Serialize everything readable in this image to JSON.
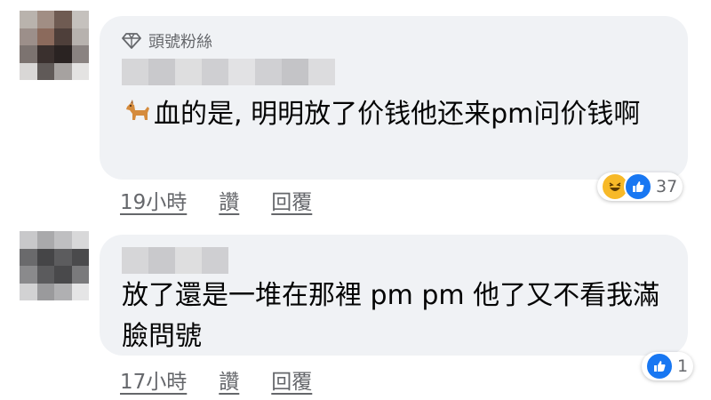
{
  "colors": {
    "bubble_bg": "#f0f2f5",
    "text_primary": "#050505",
    "text_secondary": "#65676b",
    "like_blue": "#1877f2",
    "haha_yellow": "#f7b928"
  },
  "comments": [
    {
      "badge_icon": "diamond-icon",
      "badge_label": "頭號粉絲",
      "author_icon": "dog-emoji-icon",
      "text": "血的是, 明明放了价钱他还来pm问价钱啊",
      "time": "19小時",
      "like_label": "讚",
      "reply_label": "回覆",
      "reactions": [
        "haha-icon",
        "like-icon"
      ],
      "reaction_count": "37"
    },
    {
      "text": "放了還是一堆在那裡 pm pm 他了又不看我滿臉問號",
      "time": "17小時",
      "like_label": "讚",
      "reply_label": "回覆",
      "reactions": [
        "like-icon"
      ],
      "reaction_count": "1"
    }
  ]
}
